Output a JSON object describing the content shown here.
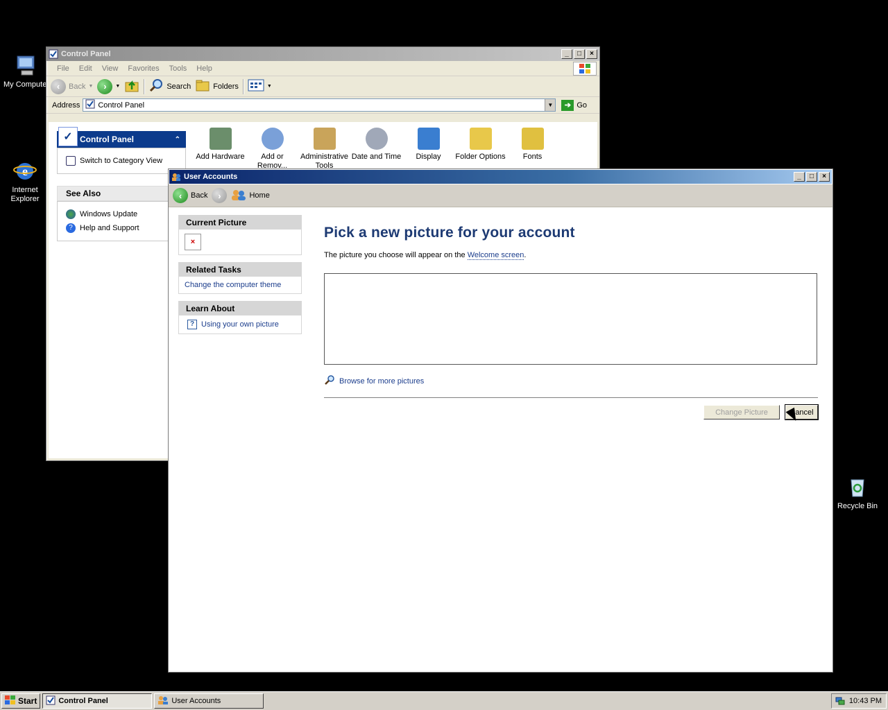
{
  "desktop": {
    "icons": [
      {
        "label": "My Computer"
      },
      {
        "label": "Internet Explorer"
      },
      {
        "label": "Recycle Bin"
      }
    ]
  },
  "control_panel": {
    "title": "Control Panel",
    "menu": [
      "File",
      "Edit",
      "View",
      "Favorites",
      "Tools",
      "Help"
    ],
    "toolbar": {
      "back": "Back",
      "search": "Search",
      "folders": "Folders"
    },
    "address_label": "Address",
    "address_value": "Control Panel",
    "go_label": "Go",
    "task_panel": {
      "title": "Control Panel",
      "switch_link": "Switch to Category View",
      "see_also_title": "See Also",
      "see_also": [
        "Windows Update",
        "Help and Support"
      ]
    },
    "applets": [
      {
        "label": "Add Hardware",
        "color": "#6b8e6b"
      },
      {
        "label": "Add or Remov...",
        "color": "#7aa0d8"
      },
      {
        "label": "Administrative Tools",
        "color": "#c9a45a"
      },
      {
        "label": "Date and Time",
        "color": "#a0a8b8"
      },
      {
        "label": "Display",
        "color": "#3a7ed0"
      },
      {
        "label": "Folder Options",
        "color": "#e8c84a"
      },
      {
        "label": "Fonts",
        "color": "#e0c040"
      }
    ]
  },
  "user_accounts": {
    "title": "User Accounts",
    "toolbar": {
      "back": "Back",
      "home": "Home"
    },
    "current_picture": {
      "title": "Current Picture",
      "broken_glyph": "×"
    },
    "related_tasks": {
      "title": "Related Tasks",
      "link": "Change the computer theme"
    },
    "learn_about": {
      "title": "Learn About",
      "link": "Using your own picture"
    },
    "heading": "Pick a new picture for your account",
    "description_prefix": "The picture you choose will appear on the ",
    "description_link": "Welcome screen",
    "description_suffix": ".",
    "browse_link": "Browse for more pictures",
    "change_button": "Change Picture",
    "cancel_button": "Cancel"
  },
  "taskbar": {
    "start": "Start",
    "tasks": [
      "Control Panel",
      "User Accounts"
    ],
    "clock": "10:43 PM"
  }
}
